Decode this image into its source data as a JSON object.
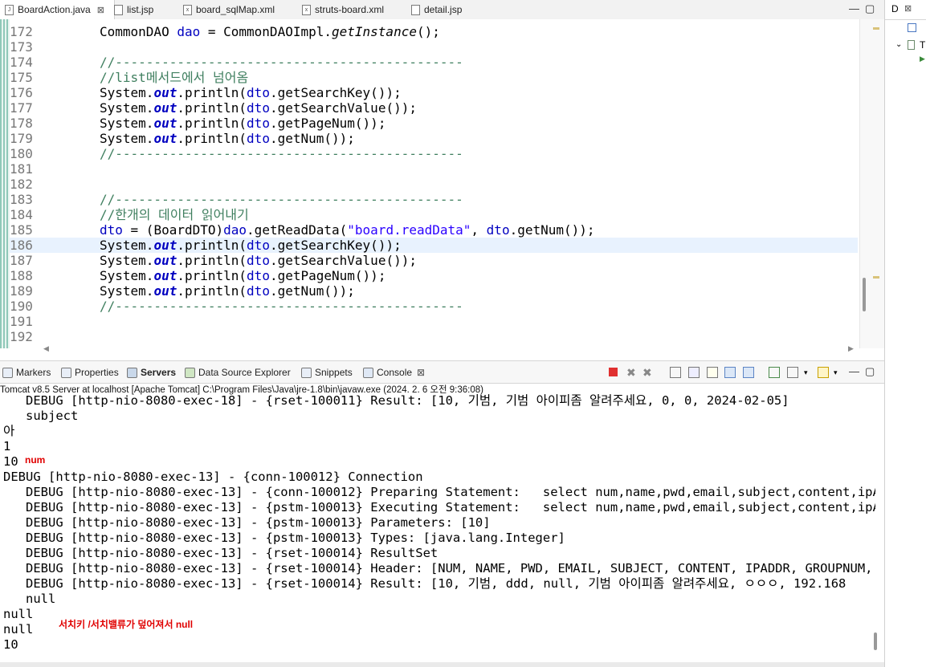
{
  "editor_tabs": [
    {
      "label": "BoardAction.java",
      "active": true,
      "close": "⊠"
    },
    {
      "label": "list.jsp",
      "active": false
    },
    {
      "label": "board_sqlMap.xml",
      "active": false
    },
    {
      "label": "struts-board.xml",
      "active": false
    },
    {
      "label": "detail.jsp",
      "active": false
    }
  ],
  "right_pane": {
    "tab_label": "D",
    "close": "⊠",
    "tree_letter": "T"
  },
  "code_lines": [
    {
      "n": "172",
      "segments": [
        {
          "t": "CommonDAO ",
          "c": ""
        },
        {
          "t": "dao",
          "c": "c-var"
        },
        {
          "t": " = CommonDAOImpl.",
          "c": ""
        },
        {
          "t": "getInstance",
          "c": "c-it"
        },
        {
          "t": "();",
          "c": ""
        }
      ]
    },
    {
      "n": "173",
      "segments": []
    },
    {
      "n": "174",
      "segments": [
        {
          "t": "//---------------------------------------------",
          "c": "c-com"
        }
      ]
    },
    {
      "n": "175",
      "segments": [
        {
          "t": "//list메서드에서 넘어옴",
          "c": "c-com"
        }
      ]
    },
    {
      "n": "176",
      "segments": [
        {
          "t": "System.",
          "c": ""
        },
        {
          "t": "out",
          "c": "c-fld"
        },
        {
          "t": ".println(",
          "c": ""
        },
        {
          "t": "dto",
          "c": "c-var"
        },
        {
          "t": ".getSearchKey());",
          "c": ""
        }
      ]
    },
    {
      "n": "177",
      "segments": [
        {
          "t": "System.",
          "c": ""
        },
        {
          "t": "out",
          "c": "c-fld"
        },
        {
          "t": ".println(",
          "c": ""
        },
        {
          "t": "dto",
          "c": "c-var"
        },
        {
          "t": ".getSearchValue());",
          "c": ""
        }
      ]
    },
    {
      "n": "178",
      "segments": [
        {
          "t": "System.",
          "c": ""
        },
        {
          "t": "out",
          "c": "c-fld"
        },
        {
          "t": ".println(",
          "c": ""
        },
        {
          "t": "dto",
          "c": "c-var"
        },
        {
          "t": ".getPageNum());",
          "c": ""
        }
      ]
    },
    {
      "n": "179",
      "segments": [
        {
          "t": "System.",
          "c": ""
        },
        {
          "t": "out",
          "c": "c-fld"
        },
        {
          "t": ".println(",
          "c": ""
        },
        {
          "t": "dto",
          "c": "c-var"
        },
        {
          "t": ".getNum());",
          "c": ""
        }
      ]
    },
    {
      "n": "180",
      "segments": [
        {
          "t": "//---------------------------------------------",
          "c": "c-com"
        }
      ]
    },
    {
      "n": "181",
      "segments": []
    },
    {
      "n": "182",
      "segments": []
    },
    {
      "n": "183",
      "segments": [
        {
          "t": "//---------------------------------------------",
          "c": "c-com"
        }
      ]
    },
    {
      "n": "184",
      "segments": [
        {
          "t": "//한개의 데이터 읽어내기",
          "c": "c-com"
        }
      ]
    },
    {
      "n": "185",
      "segments": [
        {
          "t": "dto",
          "c": "c-var"
        },
        {
          "t": " = (BoardDTO)",
          "c": ""
        },
        {
          "t": "dao",
          "c": "c-var"
        },
        {
          "t": ".getReadData(",
          "c": ""
        },
        {
          "t": "\"board.readData\"",
          "c": "c-str"
        },
        {
          "t": ", ",
          "c": ""
        },
        {
          "t": "dto",
          "c": "c-var"
        },
        {
          "t": ".getNum());",
          "c": ""
        }
      ]
    },
    {
      "n": "186",
      "hl": true,
      "segments": [
        {
          "t": "System.",
          "c": ""
        },
        {
          "t": "out",
          "c": "c-fld"
        },
        {
          "t": ".println(",
          "c": ""
        },
        {
          "t": "dto",
          "c": "c-var"
        },
        {
          "t": ".getSearchKey());",
          "c": ""
        }
      ]
    },
    {
      "n": "187",
      "segments": [
        {
          "t": "System.",
          "c": ""
        },
        {
          "t": "out",
          "c": "c-fld"
        },
        {
          "t": ".println(",
          "c": ""
        },
        {
          "t": "dto",
          "c": "c-var"
        },
        {
          "t": ".getSearchValue());",
          "c": ""
        }
      ]
    },
    {
      "n": "188",
      "segments": [
        {
          "t": "System.",
          "c": ""
        },
        {
          "t": "out",
          "c": "c-fld"
        },
        {
          "t": ".println(",
          "c": ""
        },
        {
          "t": "dto",
          "c": "c-var"
        },
        {
          "t": ".getPageNum());",
          "c": ""
        }
      ]
    },
    {
      "n": "189",
      "segments": [
        {
          "t": "System.",
          "c": ""
        },
        {
          "t": "out",
          "c": "c-fld"
        },
        {
          "t": ".println(",
          "c": ""
        },
        {
          "t": "dto",
          "c": "c-var"
        },
        {
          "t": ".getNum());",
          "c": ""
        }
      ]
    },
    {
      "n": "190",
      "segments": [
        {
          "t": "//---------------------------------------------",
          "c": "c-com"
        }
      ]
    },
    {
      "n": "191",
      "segments": []
    },
    {
      "n": "192",
      "segments": []
    }
  ],
  "view_tabs": [
    {
      "label": "Markers",
      "icon": "markers-icon"
    },
    {
      "label": "Properties",
      "icon": "properties-icon"
    },
    {
      "label": "Servers",
      "icon": "servers-icon",
      "bold": true
    },
    {
      "label": "Data Source Explorer",
      "icon": "data-source-icon"
    },
    {
      "label": "Snippets",
      "icon": "snippets-icon"
    },
    {
      "label": "Console",
      "icon": "console-icon",
      "close": "⊠"
    }
  ],
  "console": {
    "header": "Tomcat v8.5 Server at localhost [Apache Tomcat] C:\\Program Files\\Java\\jre-1.8\\bin\\javaw.exe  (2024. 2. 6 오전 9:36:08)",
    "lines": [
      "   DEBUG [http-nio-8080-exec-18] - {rset-100011} Result: [10, 기범, 기범 아이피좀 알려주세요, 0, 0, 2024-02-05]",
      "   subject",
      "아",
      "1",
      "10",
      "DEBUG [http-nio-8080-exec-13] - {conn-100012} Connection",
      "   DEBUG [http-nio-8080-exec-13] - {conn-100012} Preparing Statement:   select num,name,pwd,email,subject,content,ipAddr",
      "   DEBUG [http-nio-8080-exec-13] - {pstm-100013} Executing Statement:   select num,name,pwd,email,subject,content,ipAddr",
      "   DEBUG [http-nio-8080-exec-13] - {pstm-100013} Parameters: [10]",
      "   DEBUG [http-nio-8080-exec-13] - {pstm-100013} Types: [java.lang.Integer]",
      "   DEBUG [http-nio-8080-exec-13] - {rset-100014} ResultSet",
      "   DEBUG [http-nio-8080-exec-13] - {rset-100014} Header: [NUM, NAME, PWD, EMAIL, SUBJECT, CONTENT, IPADDR, GROUPNUM, DEP",
      "   DEBUG [http-nio-8080-exec-13] - {rset-100014} Result: [10, 기범, ddd, null, 기범 아이피좀 알려주세요, ㅇㅇㅇ, 192.168",
      "   null",
      "null",
      "null",
      "10"
    ],
    "annotation_num": "num",
    "annotation_null": "서치키 /서치밸류가 덮어져서 null"
  },
  "colors": {
    "comment": "#3f7f5f",
    "field": "#0000c0",
    "string": "#2a00ff",
    "annotation": "#e00000",
    "highlight": "#e8f2fe"
  }
}
